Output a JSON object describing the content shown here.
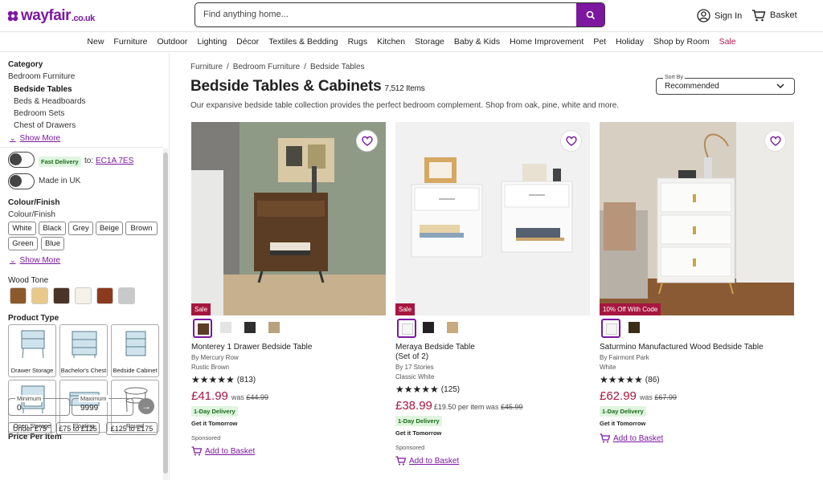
{
  "header": {
    "logo_text": "wayfair",
    "logo_suffix": ".co.uk",
    "search_placeholder": "Find anything home...",
    "sign_in": "Sign In",
    "basket": "Basket",
    "brand_color": "#7b189f"
  },
  "nav": [
    "New",
    "Furniture",
    "Outdoor",
    "Lighting",
    "Décor",
    "Textiles & Bedding",
    "Rugs",
    "Kitchen",
    "Storage",
    "Baby & Kids",
    "Home Improvement",
    "Pet",
    "Holiday",
    "Shop by Room",
    "Sale"
  ],
  "sidebar": {
    "category_title": "Category",
    "category_parent": "Bedroom Furniture",
    "category_items": [
      "Bedside Tables",
      "Beds & Headboards",
      "Bedroom Sets",
      "Chest of Drawers"
    ],
    "show_more": "Show More",
    "fast_delivery_badge": "Fast Delivery",
    "fast_delivery_to": "to:",
    "postcode": "EC1A 7ES",
    "made_in_uk": "Made in UK",
    "colour_title": "Colour/Finish",
    "colour_subtitle": "Colour/Finish",
    "colours": [
      "White",
      "Black",
      "Grey",
      "Beige",
      "Brown",
      "Green",
      "Blue"
    ],
    "show_more_2": "Show More",
    "wood_tone_title": "Wood Tone",
    "wood_tones": [
      "#8a5a2b",
      "#e8c98a",
      "#4a3327",
      "#f4f1ea",
      "#8b3a1e",
      "#c9c9c9"
    ],
    "product_type_title": "Product Type",
    "product_types": [
      "Drawer Storage",
      "Bachelor's Chest",
      "Bedside Cabinet",
      "Open Storage",
      "Floating",
      "Round"
    ],
    "price_title": "Price Per Item",
    "min_label": "Minimum",
    "min_value": "0",
    "max_label": "Maximum",
    "max_value": "9999",
    "price_chips": [
      "Under £75",
      "£75 to £125",
      "£125 to £175"
    ]
  },
  "breadcrumbs": [
    "Furniture",
    "Bedroom Furniture",
    "Bedside Tables"
  ],
  "page_title": "Bedside Tables & Cabinets",
  "item_count": "7,512 Items",
  "description": "Our expansive bedside table collection provides the perfect bedroom complement. Shop from oak, pine, white and more.",
  "sort": {
    "label": "Sort By",
    "value": "Recommended"
  },
  "products": [
    {
      "badge": "Sale",
      "name": "Monterey 1 Drawer Bedside Table",
      "name2": "",
      "by": "By Mercury Row",
      "variant": "Rustic Brown",
      "stars": "★★★★★",
      "reviews": "(813)",
      "price": "£41.99",
      "per": "",
      "was_label": "was",
      "was": "£44.99",
      "delivery": "1-Day Delivery",
      "tomorrow": "Get it Tomorrow",
      "sponsored": "Sponsored",
      "add": "Add to Basket"
    },
    {
      "badge": "Sale",
      "name": "Meraya Bedside Table",
      "name2": "(Set of 2)",
      "by": "By 17 Stories",
      "variant": "Classic White",
      "stars": "★★★★★",
      "reviews": "(125)",
      "price": "£38.99",
      "per": "£19.50 per item",
      "was_label": "was",
      "was": "£45.99",
      "delivery": "1-Day Delivery",
      "tomorrow": "Get it Tomorrow",
      "sponsored": "Sponsored",
      "add": "Add to Basket"
    },
    {
      "badge": "10% Off With Code",
      "name": "Saturmino Manufactured Wood Bedside Table",
      "name2": "",
      "by": "By Fairmont Park",
      "variant": "White",
      "stars": "★★★★★",
      "reviews": "(86)",
      "price": "£62.99",
      "per": "",
      "was_label": "was",
      "was": "£67.99",
      "delivery": "1-Day Delivery",
      "tomorrow": "Get it Tomorrow",
      "sponsored": "",
      "add": "Add to Basket"
    }
  ]
}
